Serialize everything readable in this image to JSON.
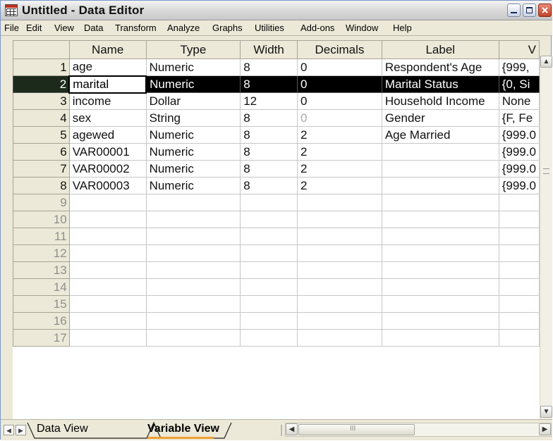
{
  "window": {
    "title": "Untitled - Data Editor"
  },
  "menu": [
    "File",
    "Edit",
    "View",
    "Data",
    "Transform",
    "Analyze",
    "Graphs",
    "Utilities",
    "Add-ons",
    "Window",
    "Help"
  ],
  "columns": [
    "Name",
    "Type",
    "Width",
    "Decimals",
    "Label",
    "V"
  ],
  "variables": [
    {
      "row": "1",
      "name": "age",
      "type": "Numeric",
      "width": "8",
      "decimals": "0",
      "label": "Respondent's Age",
      "values": "{999,"
    },
    {
      "row": "2",
      "name": "marital",
      "type": "Numeric",
      "width": "8",
      "decimals": "0",
      "label": "Marital Status",
      "values": "{0, Si"
    },
    {
      "row": "3",
      "name": "income",
      "type": "Dollar",
      "width": "12",
      "decimals": "0",
      "label": "Household Income",
      "values": "None"
    },
    {
      "row": "4",
      "name": "sex",
      "type": "String",
      "width": "8",
      "decimals": "0",
      "label": "Gender",
      "values": "{F, Fe"
    },
    {
      "row": "5",
      "name": "agewed",
      "type": "Numeric",
      "width": "8",
      "decimals": "2",
      "label": "Age Married",
      "values": "{999.0"
    },
    {
      "row": "6",
      "name": "VAR00001",
      "type": "Numeric",
      "width": "8",
      "decimals": "2",
      "label": "",
      "values": "{999.0"
    },
    {
      "row": "7",
      "name": "VAR00002",
      "type": "Numeric",
      "width": "8",
      "decimals": "2",
      "label": "",
      "values": "{999.0"
    },
    {
      "row": "8",
      "name": "VAR00003",
      "type": "Numeric",
      "width": "8",
      "decimals": "2",
      "label": "",
      "values": "{999.0"
    }
  ],
  "empty_rows": [
    "9",
    "10",
    "11",
    "12",
    "13",
    "14",
    "15",
    "16",
    "17"
  ],
  "selected_row": "2",
  "tabs": {
    "data_view": "Data View",
    "variable_view": "Variable View"
  },
  "scroll_glyphs": {
    "up": "▲",
    "down": "▼",
    "left": "◀",
    "right": "▶",
    "grip": "III"
  }
}
